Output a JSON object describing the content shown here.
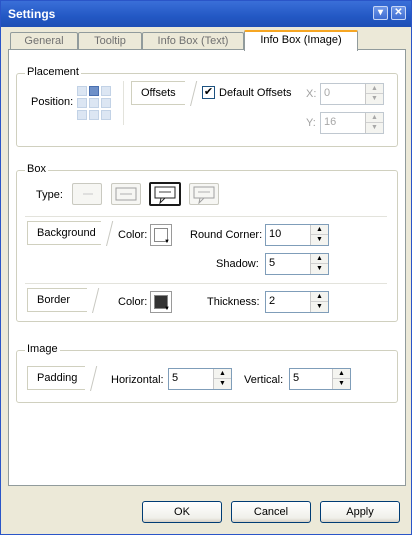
{
  "window": {
    "title": "Settings",
    "minimize_icon": "minimize-icon",
    "close_icon": "close-icon",
    "close_glyph": "✕",
    "min_glyph": "▾"
  },
  "tabs": [
    {
      "label": "General",
      "active": false
    },
    {
      "label": "Tooltip",
      "active": false
    },
    {
      "label": "Info Box (Text)",
      "active": false
    },
    {
      "label": "Info Box (Image)",
      "active": true
    }
  ],
  "placement": {
    "heading": "Placement",
    "position_label": "Position:",
    "offsets_tab": "Offsets",
    "default_offsets_label": "Default Offsets",
    "default_offsets_checked": true,
    "check_glyph": "✔",
    "x_label": "X:",
    "x_value": "0",
    "y_label": "Y:",
    "y_value": "16"
  },
  "box": {
    "heading": "Box",
    "type_label": "Type:",
    "type_options": [
      "type-plain",
      "type-rectangle",
      "type-callout",
      "type-callout-light"
    ],
    "type_selected": "type-callout",
    "background_tab": "Background",
    "bg_color_label": "Color:",
    "round_corner_label": "Round Corner:",
    "round_corner_value": "10",
    "shadow_label": "Shadow:",
    "shadow_value": "5",
    "border_tab": "Border",
    "border_color_label": "Color:",
    "thickness_label": "Thickness:",
    "thickness_value": "2"
  },
  "image": {
    "heading": "Image",
    "padding_tab": "Padding",
    "horizontal_label": "Horizontal:",
    "horizontal_value": "5",
    "vertical_label": "Vertical:",
    "vertical_value": "5"
  },
  "buttons": {
    "ok": "OK",
    "cancel": "Cancel",
    "apply": "Apply"
  },
  "spin_glyphs": {
    "up": "▲",
    "down": "▼",
    "dropdown": "▼"
  },
  "colors": {
    "titlebar": "#2358c4",
    "active_tab_accent": "#f6a623",
    "bg_color": "#ffffff",
    "border_color": "#333333"
  }
}
